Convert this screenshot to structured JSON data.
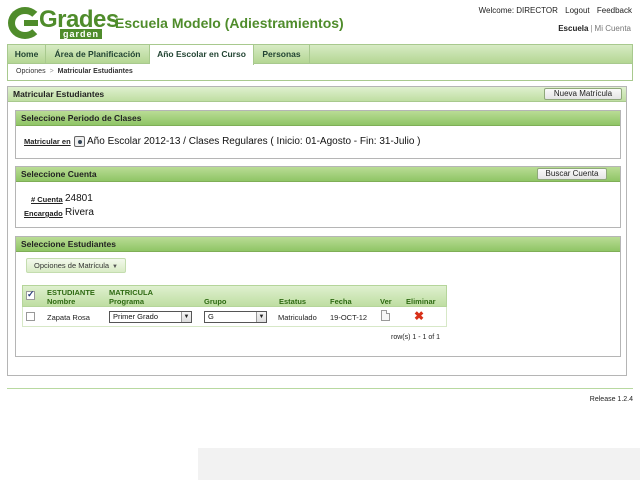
{
  "colors": {
    "brand_green": "#4f8c2b",
    "tab_green": "#b4d693",
    "delete_red": "#d83018"
  },
  "header": {
    "logo_word": "Grades",
    "logo_sub": "garden",
    "school_name": "Escuela Modelo (Adiestramientos)",
    "welcome": "Welcome: DIRECTOR",
    "logout": "Logout",
    "feedback": "Feedback",
    "school_link": "Escuela",
    "separator": "|",
    "account_link": "Mi Cuenta"
  },
  "nav": {
    "tabs": [
      {
        "label": "Home"
      },
      {
        "label": "Área de Planificación"
      },
      {
        "label": "Año Escolar en Curso"
      },
      {
        "label": "Personas"
      }
    ],
    "breadcrumb": {
      "parent": "Opciones",
      "arrow": ">",
      "current": "Matricular Estudiantes"
    }
  },
  "main": {
    "title": "Matricular Estudiantes",
    "new_button": "Nueva Matrícula"
  },
  "periodo": {
    "title": "Seleccione Periodo de Clases",
    "label": "Matricular en",
    "value": "Año Escolar 2012-13 / Clases Regulares ( Inicio: 01-Agosto - Fin: 31-Julio )"
  },
  "cuenta": {
    "title": "Seleccione Cuenta",
    "search_button": "Buscar Cuenta",
    "account_label": "# Cuenta",
    "account_value": "24801",
    "guardian_label": "Encargado",
    "guardian_value": "Rivera"
  },
  "estudiantes": {
    "title": "Seleccione Estudiantes",
    "options_button": "Opciones de Matrícula",
    "columns": {
      "student_1": "ESTUDIANTE",
      "student_2": "Nombre",
      "matricula_1": "MATRICULA",
      "matricula_2": "Programa",
      "grupo": "Grupo",
      "estatus": "Estatus",
      "fecha": "Fecha",
      "ver": "Ver",
      "eliminar": "Eliminar"
    },
    "rows": [
      {
        "nombre": "Zapata Rosa",
        "programa": "Primer Grado",
        "grupo": "G",
        "estatus": "Matriculado",
        "fecha": "19-OCT-12",
        "ver_icon": "document-icon",
        "eliminar_icon": "delete-x-icon"
      }
    ],
    "pager": "row(s) 1 - 1 of 1"
  },
  "footer": {
    "release": "Release 1.2.4"
  }
}
